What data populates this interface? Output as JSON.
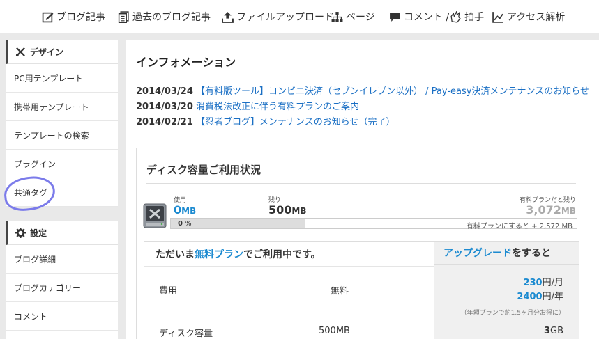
{
  "nav": {
    "items": [
      {
        "label": "ブログ記事",
        "icon": "edit-icon"
      },
      {
        "label": "過去のブログ記事",
        "icon": "documents-icon"
      },
      {
        "label": "ファイルアップロード",
        "icon": "upload-icon"
      },
      {
        "label": "ページ",
        "icon": "sitemap-icon"
      },
      {
        "label": "コメント / ",
        "label2": "拍手",
        "icon": "comment-icon"
      },
      {
        "label": "アクセス解析",
        "icon": "chart-icon"
      }
    ]
  },
  "sidebar": {
    "design": {
      "heading": "デザイン",
      "items": [
        "PC用テンプレート",
        "携帯用テンプレート",
        "テンプレートの検索",
        "プラグイン",
        "共通タグ"
      ]
    },
    "settings": {
      "heading": "設定",
      "items": [
        "ブログ詳細",
        "ブログカテゴリー",
        "コメント"
      ]
    }
  },
  "info": {
    "title": "インフォメーション",
    "news": [
      {
        "date": "2014/03/24",
        "text": "【有料版ツール】コンビニ決済（セブンイレブン以外） / Pay-easy決済メンテナンスのお知らせ"
      },
      {
        "date": "2014/03/20",
        "text": "消費税法改正に伴う有料プランのご案内"
      },
      {
        "date": "2014/02/21",
        "text": "【忍者ブログ】メンテナンスのお知らせ（完了）"
      }
    ]
  },
  "disk": {
    "title": "ディスク容量ご利用状況",
    "used_label": "使用",
    "used_num": "0",
    "used_unit": "MB",
    "remain_label": "残り",
    "remain_num": "500",
    "remain_unit": "MB",
    "paid_label": "有料プランだと残り",
    "paid_num": "3,072",
    "paid_unit": "MB",
    "percent": "0",
    "percent_sign": "%",
    "bar_note": "有料プランにすると + 2,572 MB",
    "usage_fraction": 0.0
  },
  "plan": {
    "left_prefix": "ただいま",
    "left_accent": "無料プラン",
    "left_suffix": "でご利用中です。",
    "right_accent": "アップグレード",
    "right_suffix": "をすると",
    "fee_label": "費用",
    "fee_free": "無料",
    "price_month_num": "230",
    "price_month_unit": "円/月",
    "price_year_num": "2400",
    "price_year_unit": "円/年",
    "price_note": "（年額プランで約1.5ヶ月分お得に）",
    "disk_label": "ディスク容量",
    "disk_free": "500MB",
    "disk_paid_num": "3",
    "disk_paid_unit": "GB"
  },
  "colors": {
    "accent": "#1b8ad0",
    "link": "#1a6fc4",
    "annotation": "#7b7bea"
  }
}
